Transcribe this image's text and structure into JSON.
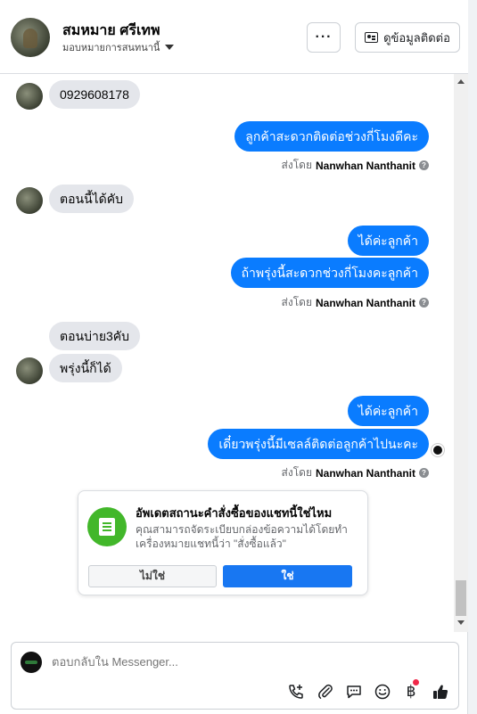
{
  "header": {
    "name": "สมหมาย ศรีเทพ",
    "assign_label": "มอบหมายการสนทนานี้",
    "more_label": "···",
    "contact_label": "ดูข้อมูลติดต่อ"
  },
  "messages": [
    {
      "dir": "in",
      "text": "0929608178"
    },
    {
      "dir": "out",
      "text": "ลูกค้าสะดวกติดต่อช่วงกี่โมงดีคะ"
    },
    {
      "dir": "in",
      "text": "ตอนนี้ได้คับ"
    },
    {
      "dir": "out",
      "text": "ได้ค่ะลูกค้า"
    },
    {
      "dir": "out",
      "text": "ถ้าพรุ่งนี้สะดวกช่วงกี่โมงคะลูกค้า"
    },
    {
      "dir": "in",
      "text": "ตอนบ่าย3คับ"
    },
    {
      "dir": "in",
      "text": "พรุ่งนี้ก็ได้"
    },
    {
      "dir": "out",
      "text": "ได้ค่ะลูกค้า"
    },
    {
      "dir": "out",
      "text": "เดี๋ยวพรุ่งนี้มีเซลล์ติดต่อลูกค้าไปนะคะ"
    }
  ],
  "sent_by": {
    "prefix": "ส่งโดย",
    "sender": "Nanwhan Nanthanit"
  },
  "order_prompt": {
    "title": "อัพเดตสถานะคำสั่งซื้อของแชทนี้ใช่ไหม",
    "body": "คุณสามารถจัดระเบียบกล่องข้อความได้โดยทำเครื่องหมายแชทนี้ว่า \"สั่งซื้อแล้ว\"",
    "no_label": "ไม่ใช่",
    "yes_label": "ใช่",
    "accent_color": "#42b72a"
  },
  "composer": {
    "placeholder": "ตอบกลับใน Messenger..."
  },
  "colors": {
    "outgoing_bubble": "#0a7cff",
    "incoming_bubble": "#e4e6eb",
    "primary_button": "#1877f2"
  },
  "tools": [
    "call-add-icon",
    "paperclip-icon",
    "saved-reply-icon",
    "emoji-icon",
    "baht-payment-icon",
    "thumbs-up-icon"
  ]
}
